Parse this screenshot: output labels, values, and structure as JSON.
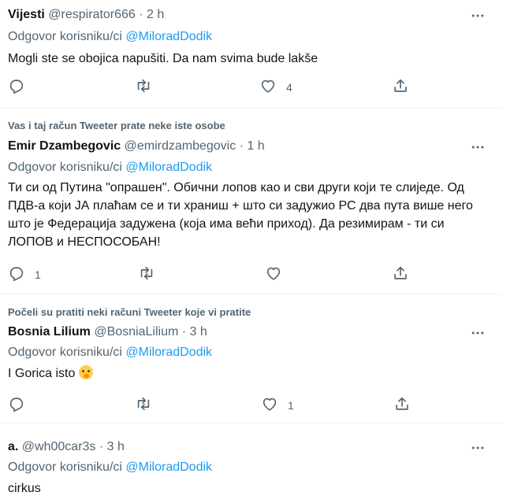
{
  "tweets": [
    {
      "context": "",
      "name": "Vijesti",
      "handle": "@respirator666",
      "time": "· 2 h",
      "reply_prefix": "Odgovor korisniku/ci",
      "reply_to": "@MiloradDodik",
      "text": "Mogli ste se obojica napušiti. Da nam svima bude lakše",
      "counts": {
        "reply": "",
        "retweet": "",
        "like": "4"
      }
    },
    {
      "context": "Vas i taj račun Tweeter prate neke iste osobe",
      "name": "Emir Dzambegovic",
      "handle": "@emirdzambegovic",
      "time": "· 1 h",
      "reply_prefix": "Odgovor korisniku/ci",
      "reply_to": "@MiloradDodik",
      "text": "Ти си од Путина \"опрашен\". Обични лопов као и сви други који те слиједе. Од ПДВ-а који ЈА плаћам се и ти храниш + што си задужио РС два пута више него што је Федерација задужена (која има већи приход). Да резимирам - ти си ЛОПОВ и НЕСПОСОБАН!",
      "counts": {
        "reply": "1",
        "retweet": "",
        "like": ""
      }
    },
    {
      "context": "Počeli su pratiti neki računi Tweeter koje vi pratite",
      "name": "Bosnia Lilium",
      "handle": "@BosniaLilium",
      "time": "· 3 h",
      "reply_prefix": "Odgovor korisniku/ci",
      "reply_to": "@MiloradDodik",
      "text": "I Gorica isto",
      "counts": {
        "reply": "",
        "retweet": "",
        "like": "1"
      }
    },
    {
      "context": "",
      "name": "a.",
      "handle": "@wh00car3s",
      "time": "· 3 h",
      "reply_prefix": "Odgovor korisniku/ci",
      "reply_to": "@MiloradDodik",
      "text": "cirkus",
      "counts": {
        "reply": "",
        "retweet": "",
        "like": ""
      }
    }
  ],
  "icons": {
    "more": "more-options-icon",
    "reply": "reply-icon",
    "retweet": "retweet-icon",
    "like": "like-icon",
    "share": "share-icon",
    "emoji": "shushing-face-emoji"
  },
  "colors": {
    "accent": "#1d9bf0",
    "secondary_text": "#536471",
    "divider": "#eff3f4"
  }
}
